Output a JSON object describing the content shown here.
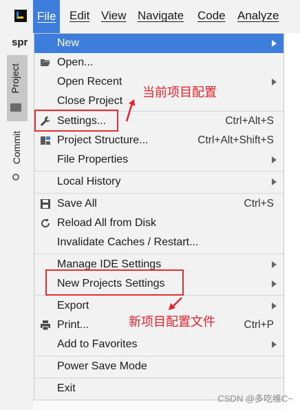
{
  "menubar": {
    "items": [
      "File",
      "Edit",
      "View",
      "Navigate",
      "Code",
      "Analyze"
    ]
  },
  "left_panel": {
    "project_crumb": "spr",
    "project_tab": "Project",
    "commit_tab": "Commit"
  },
  "file_menu": {
    "items": [
      {
        "label": "New",
        "shortcut": "",
        "submenu": true
      },
      {
        "label": "Open...",
        "shortcut": "",
        "submenu": false,
        "icon": "folder-open-icon"
      },
      {
        "label": "Open Recent",
        "shortcut": "",
        "submenu": true
      },
      {
        "label": "Close Project",
        "shortcut": "",
        "submenu": false
      },
      {
        "label": "Settings...",
        "shortcut": "Ctrl+Alt+S",
        "submenu": false,
        "icon": "wrench-icon"
      },
      {
        "label": "Project Structure...",
        "shortcut": "Ctrl+Alt+Shift+S",
        "submenu": false,
        "icon": "project-structure-icon"
      },
      {
        "label": "File Properties",
        "shortcut": "",
        "submenu": true
      },
      {
        "label": "Local History",
        "shortcut": "",
        "submenu": true
      },
      {
        "label": "Save All",
        "shortcut": "Ctrl+S",
        "submenu": false,
        "icon": "save-icon"
      },
      {
        "label": "Reload All from Disk",
        "shortcut": "",
        "submenu": false,
        "icon": "reload-icon"
      },
      {
        "label": "Invalidate Caches / Restart...",
        "shortcut": "",
        "submenu": false
      },
      {
        "label": "Manage IDE Settings",
        "shortcut": "",
        "submenu": true
      },
      {
        "label": "New Projects Settings",
        "shortcut": "",
        "submenu": true
      },
      {
        "label": "Export",
        "shortcut": "",
        "submenu": true
      },
      {
        "label": "Print...",
        "shortcut": "Ctrl+P",
        "submenu": false,
        "icon": "print-icon"
      },
      {
        "label": "Add to Favorites",
        "shortcut": "",
        "submenu": true
      },
      {
        "label": "Power Save Mode",
        "shortcut": "",
        "submenu": false
      },
      {
        "label": "Exit",
        "shortcut": "",
        "submenu": false
      }
    ]
  },
  "annotations": {
    "current_project_config": "当前项目配置",
    "new_project_config_file": "新项目配置文件"
  },
  "watermark": "CSDN @多吃维C~",
  "colors": {
    "accent": "#3d7ddb",
    "annotation_red": "#e03030",
    "menu_bg": "#f2f2f2"
  }
}
